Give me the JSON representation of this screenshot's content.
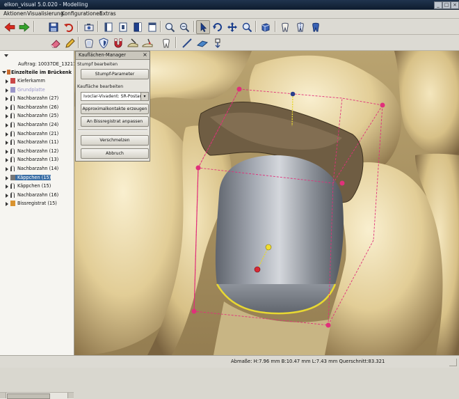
{
  "window": {
    "title": "elkon_visual 5.0.020 - Modelling"
  },
  "menu": [
    "Aktionen",
    "Visualisierung",
    "Konfigurationen",
    "Extras"
  ],
  "toolbar1": [
    "back-arrow-icon",
    "forward-arrow-icon",
    "save-icon",
    "undo-icon",
    "camera-icon",
    "view-left-icon",
    "view-front-icon",
    "view-right-icon",
    "view-top-icon",
    "zoom-in-icon",
    "zoom-out-icon",
    "pointer-icon",
    "rotate-icon",
    "move-icon",
    "zoom-icon",
    "3d-view-icon",
    "tooth-cut-icon",
    "tooth-split-icon",
    "tooth-color-icon"
  ],
  "toolbar2": [
    "eraser-icon",
    "pencil-icon",
    "crown-icon",
    "shield-icon",
    "magnet-icon",
    "sculpt-icon",
    "wax-icon",
    "tooth-outline-icon",
    "ruler-icon",
    "plane-icon",
    "anchor-icon"
  ],
  "tree": {
    "order": "Auftrag: 10037DE_13211_",
    "root": "Einzelteile im Brückenk",
    "items": [
      {
        "label": "Kieferkamm",
        "icon": "jaw-icon"
      },
      {
        "label": "Grundplatte",
        "icon": "base-plate-icon"
      },
      {
        "label": "Nachbarzahn (27)",
        "icon": "tooth-icon"
      },
      {
        "label": "Nachbarzahn (26)",
        "icon": "tooth-icon"
      },
      {
        "label": "Nachbarzahn (25)",
        "icon": "tooth-icon"
      },
      {
        "label": "Nachbarzahn (24)",
        "icon": "tooth-icon"
      },
      {
        "label": "Nachbarzahn (21)",
        "icon": "tooth-icon"
      },
      {
        "label": "Nachbarzahn (11)",
        "icon": "tooth-icon"
      },
      {
        "label": "Nachbarzahn (12)",
        "icon": "tooth-icon"
      },
      {
        "label": "Nachbarzahn (13)",
        "icon": "tooth-icon"
      },
      {
        "label": "Nachbarzahn (14)",
        "icon": "tooth-icon"
      },
      {
        "label": "Käppchen (15)",
        "icon": "cap-icon"
      },
      {
        "label": "Käppchen (15)",
        "icon": "tooth-icon"
      },
      {
        "label": "Nachbarzahn (16)",
        "icon": "tooth-icon"
      },
      {
        "label": "Bissregistrat (15)",
        "icon": "bite-icon"
      }
    ]
  },
  "manager": {
    "title": "Kauflächen-Manager",
    "group1": "Stumpf bearbeiten",
    "btn_stump": "Stumpf-Parameter",
    "group2": "Kaufläche bearbeiten",
    "combo_value": "Ivoclar-Vivadent: SR-Postaris",
    "btn_approx": "Approximalkontakte erzeugen",
    "btn_bite": "An Bissregistrat anpassen",
    "btn_merge": "Verschmelzen",
    "btn_cancel": "Abbruch"
  },
  "status": {
    "message": "Abmaße: H:7.96 mm B:10.47 mm L:7.43 mm Querschnitt:83.321"
  },
  "colors": {
    "accent": "#e0307a",
    "highlight": "#3a6ea5",
    "cap": "#8e939c",
    "tooth": "#e6d5a6",
    "yellow": "#e8d832"
  }
}
